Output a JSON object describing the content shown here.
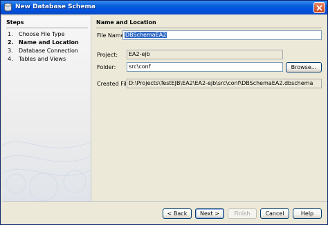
{
  "window": {
    "title": "New Database Schema"
  },
  "steps": {
    "heading": "Steps",
    "items": [
      {
        "num": "1.",
        "label": "Choose File Type"
      },
      {
        "num": "2.",
        "label": "Name and Location"
      },
      {
        "num": "3.",
        "label": "Database Connection"
      },
      {
        "num": "4.",
        "label": "Tables and Views"
      }
    ]
  },
  "form": {
    "heading": "Name and Location",
    "file_name_label": "File Name:",
    "file_name_value": "DBSchemaEA2",
    "project_label": "Project:",
    "project_value": "EA2-ejb",
    "folder_label": "Folder:",
    "folder_value": "src\\conf",
    "browse_label": "Browse...",
    "created_file_label": "Created File:",
    "created_file_value": "D:\\Projects\\TestEJB\\EA2\\EA2-ejb\\src\\conf\\DBSchemaEA2.dbschema"
  },
  "buttons": {
    "back": "< Back",
    "next": "Next >",
    "finish": "Finish",
    "cancel": "Cancel",
    "help": "Help"
  }
}
